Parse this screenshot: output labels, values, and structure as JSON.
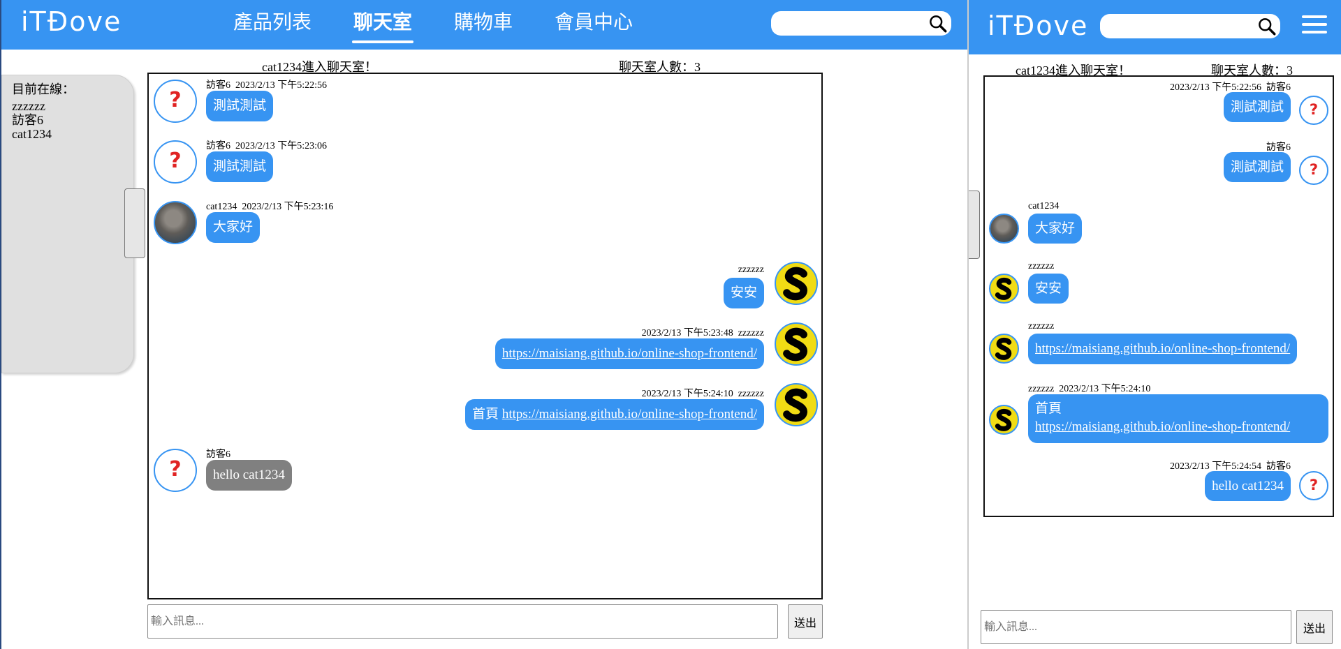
{
  "brand": {
    "logo_text": "iTĐove"
  },
  "nav": {
    "items": [
      {
        "label": "產品列表"
      },
      {
        "label": "聊天室"
      },
      {
        "label": "購物車"
      },
      {
        "label": "會員中心"
      }
    ],
    "active_index": 1
  },
  "search": {
    "value": "",
    "placeholder": ""
  },
  "room": {
    "join_notice": "cat1234進入聊天室！",
    "member_count_label": "聊天室人數：3"
  },
  "online": {
    "title": "目前在線：",
    "users": [
      "zzzzzz",
      "訪客6",
      "cat1234"
    ]
  },
  "chat_desktop": {
    "messages": [
      {
        "user": "訪客6",
        "time": "2023/2/13 下午5:22:56",
        "text": "測試測試"
      },
      {
        "user": "訪客6",
        "time": "2023/2/13 下午5:23:06",
        "text": "測試測試"
      },
      {
        "user": "cat1234",
        "time": "2023/2/13 下午5:23:16",
        "text": "大家好"
      },
      {
        "user": "zzzzzz",
        "time": "",
        "text": "安安"
      },
      {
        "user": "zzzzzz",
        "time": "2023/2/13 下午5:23:48",
        "link": "https://maisiang.github.io/online-shop-frontend/"
      },
      {
        "user": "zzzzzz",
        "time": "2023/2/13 下午5:24:10",
        "text": "首頁",
        "link": "https://maisiang.github.io/online-shop-frontend/"
      },
      {
        "user": "訪客6",
        "time": "",
        "text": "hello cat1234"
      }
    ]
  },
  "chat_mobile": {
    "messages": [
      {
        "user": "訪客6",
        "time": "2023/2/13 下午5:22:56",
        "text": "測試測試"
      },
      {
        "user": "訪客6",
        "time": "",
        "text": "測試測試"
      },
      {
        "user": "cat1234",
        "time": "",
        "text": "大家好"
      },
      {
        "user": "zzzzzz",
        "time": "",
        "text": "安安"
      },
      {
        "user": "zzzzzz",
        "time": "",
        "link": "https://maisiang.github.io/online-shop-frontend/"
      },
      {
        "user": "zzzzzz",
        "time": "2023/2/13 下午5:24:10",
        "text": "首頁",
        "link": "https://maisiang.github.io/online-shop-frontend/"
      },
      {
        "user": "訪客6",
        "time": "2023/2/13 下午5:24:54",
        "text": "hello cat1234"
      }
    ]
  },
  "composer": {
    "placeholder": "輸入訊息...",
    "send_label": "送出"
  },
  "icons": {
    "search": "search-icon",
    "menu": "hamburger-menu-icon",
    "guest_avatar_glyph": "?"
  },
  "colors": {
    "navbar": "#3794f2",
    "bubble": "#3794f2",
    "bubble_gray": "#808080",
    "guest_avatar_mark": "#e02323",
    "s_avatar": "#f1dc14"
  }
}
